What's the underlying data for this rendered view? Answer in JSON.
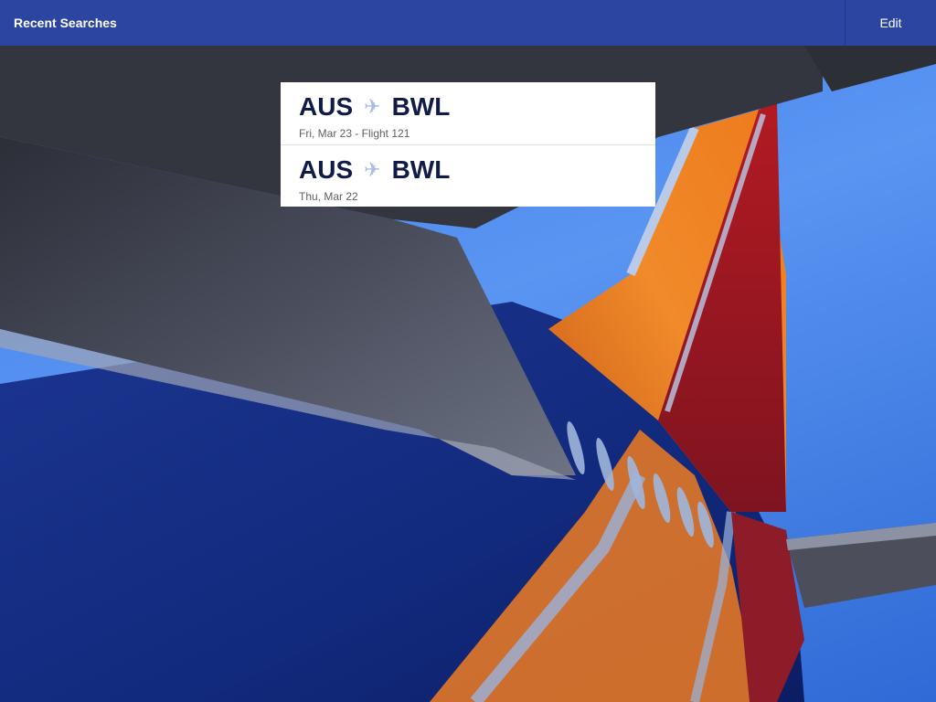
{
  "header": {
    "title": "Recent Searches",
    "edit_label": "Edit"
  },
  "searches": [
    {
      "origin": "AUS",
      "destination": "BWL",
      "detail": "Fri, Mar 23 - Flight 121",
      "icon": "plane-icon"
    },
    {
      "origin": "AUS",
      "destination": "BWL",
      "detail": "Thu, Mar 22",
      "icon": "plane-icon"
    }
  ],
  "colors": {
    "header_bg": "#2b45a0",
    "route_text": "#111b47",
    "plane_icon": "#a9bbe6",
    "sky": "#4a86ee"
  }
}
